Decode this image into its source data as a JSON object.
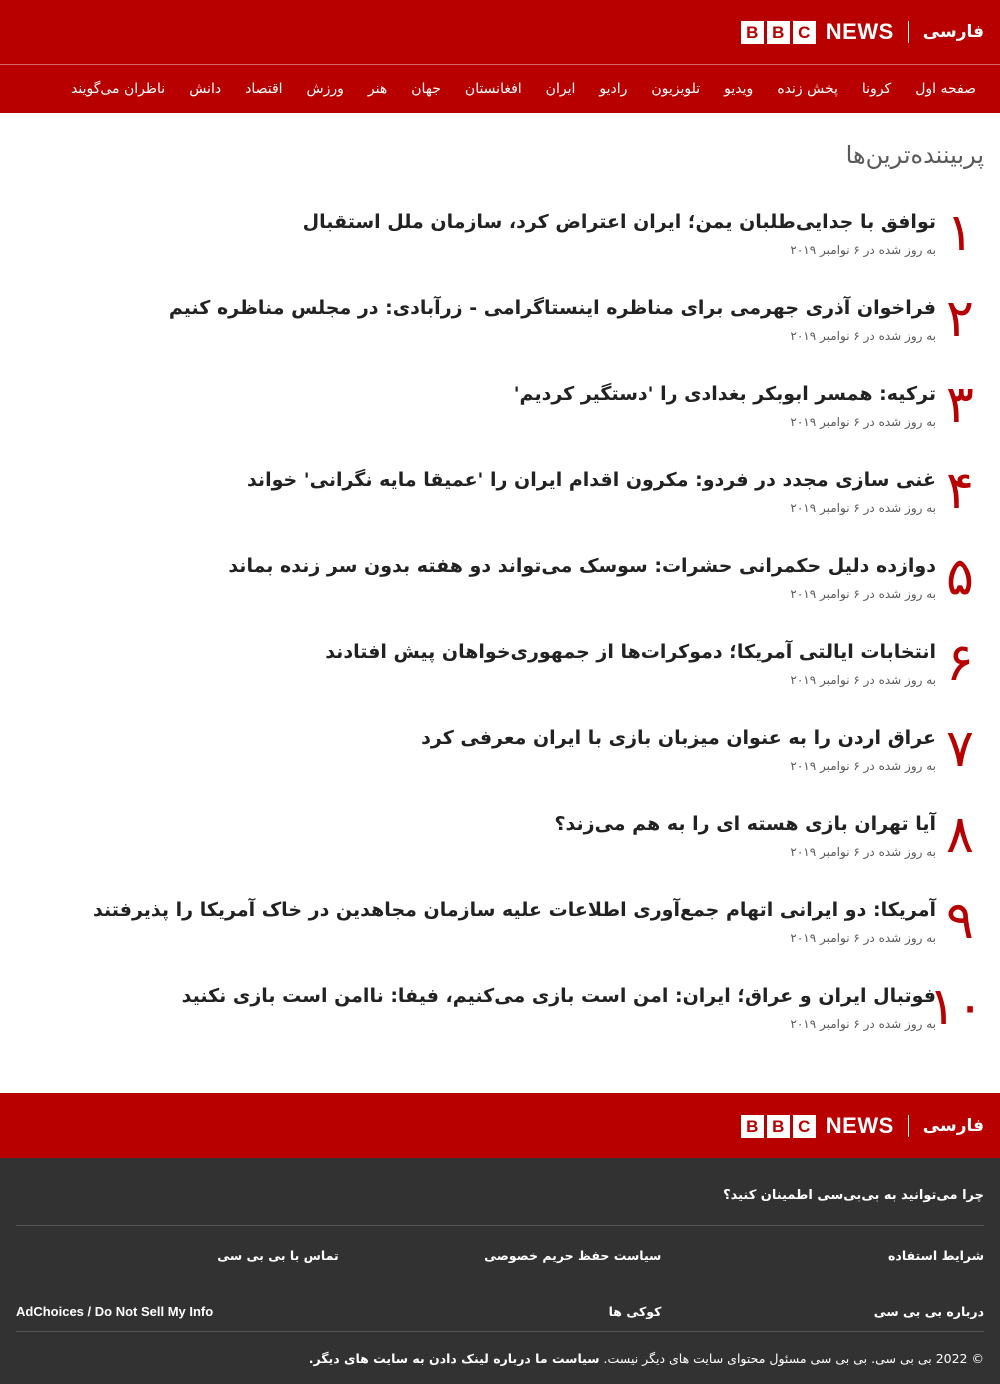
{
  "header": {
    "logo_letters": [
      "B",
      "B",
      "C"
    ],
    "news_word": "NEWS",
    "service_name": "فارسی"
  },
  "nav": {
    "items": [
      "صفحه اول",
      "کرونا",
      "پخش زنده",
      "ویدیو",
      "تلویزیون",
      "رادیو",
      "ایران",
      "افغانستان",
      "جهان",
      "هنر",
      "ورزش",
      "اقتصاد",
      "دانش",
      "ناظران می‌گویند"
    ]
  },
  "main": {
    "section_title": "پربیننده‌ترین‌ها",
    "items": [
      {
        "rank": "۱",
        "headline": "توافق با جدایی‌طلبان یمن؛ ایران اعتراض کرد، سازمان ملل استقبال",
        "meta": "به روز شده در ۶ نوامبر ۲۰۱۹"
      },
      {
        "rank": "۲",
        "headline": "فراخوان آذری جهرمی برای مناظره اینستاگرامی - زرآبادی: در مجلس مناظره کنیم",
        "meta": "به روز شده در ۶ نوامبر ۲۰۱۹"
      },
      {
        "rank": "۳",
        "headline": "ترکیه: همسر ابوبکر بغدادی را 'دستگیر کردیم'",
        "meta": "به روز شده در ۶ نوامبر ۲۰۱۹"
      },
      {
        "rank": "۴",
        "headline": "غنی سازی مجدد در فردو: مکرون اقدام ایران را 'عمیقا مایه نگرانی' خواند",
        "meta": "به روز شده در ۶ نوامبر ۲۰۱۹"
      },
      {
        "rank": "۵",
        "headline": "دوازده دلیل حکمرانی حشرات: سوسک می‌تواند دو هفته بدون سر زنده بماند",
        "meta": "به روز شده در ۶ نوامبر ۲۰۱۹"
      },
      {
        "rank": "۶",
        "headline": "انتخابات ایالتی آمریکا؛ دموکرات‌ها از جمهوری‌خواهان پیش افتادند",
        "meta": "به روز شده در ۶ نوامبر ۲۰۱۹"
      },
      {
        "rank": "۷",
        "headline": "عراق اردن را به عنوان میزبان بازی با ایران معرفی کرد",
        "meta": "به روز شده در ۶ نوامبر ۲۰۱۹"
      },
      {
        "rank": "۸",
        "headline": "آیا تهران بازی هسته ای را به هم می‌زند؟",
        "meta": "به روز شده در ۶ نوامبر ۲۰۱۹"
      },
      {
        "rank": "۹",
        "headline": "آمریکا: دو ایرانی اتهام جمع‌آوری اطلاعات علیه سازمان مجاهدین در خاک آمریکا را پذیرفتند",
        "meta": "به روز شده در ۶ نوامبر ۲۰۱۹"
      },
      {
        "rank": "۱۰",
        "headline": "فوتبال ایران و عراق؛ ایران: امن است بازی می‌کنیم، فیفا: ناامن است بازی نکنید",
        "meta": "به روز شده در ۶ نوامبر ۲۰۱۹"
      }
    ]
  },
  "footer": {
    "trust_link": "چرا می‌توانید به بی‌بی‌سی اطمینان کنید؟",
    "links": {
      "terms": "شرایط استفاده",
      "privacy": "سیاست حفظ حریم خصوصی",
      "contact": "تماس با بی بی سی",
      "about": "درباره بی بی سی",
      "cookies": "کوکی ها",
      "adchoices": "AdChoices / Do Not Sell My Info"
    },
    "copyright_text": "© 2022 بی بی سی. بی بی سی مسئول محتوای سایت های دیگر نیست.",
    "copyright_link": "سیاست ما درباره لینک دادن به سایت های دیگر."
  },
  "colors": {
    "brand_red": "#b80000",
    "footer_dark": "#323232"
  }
}
